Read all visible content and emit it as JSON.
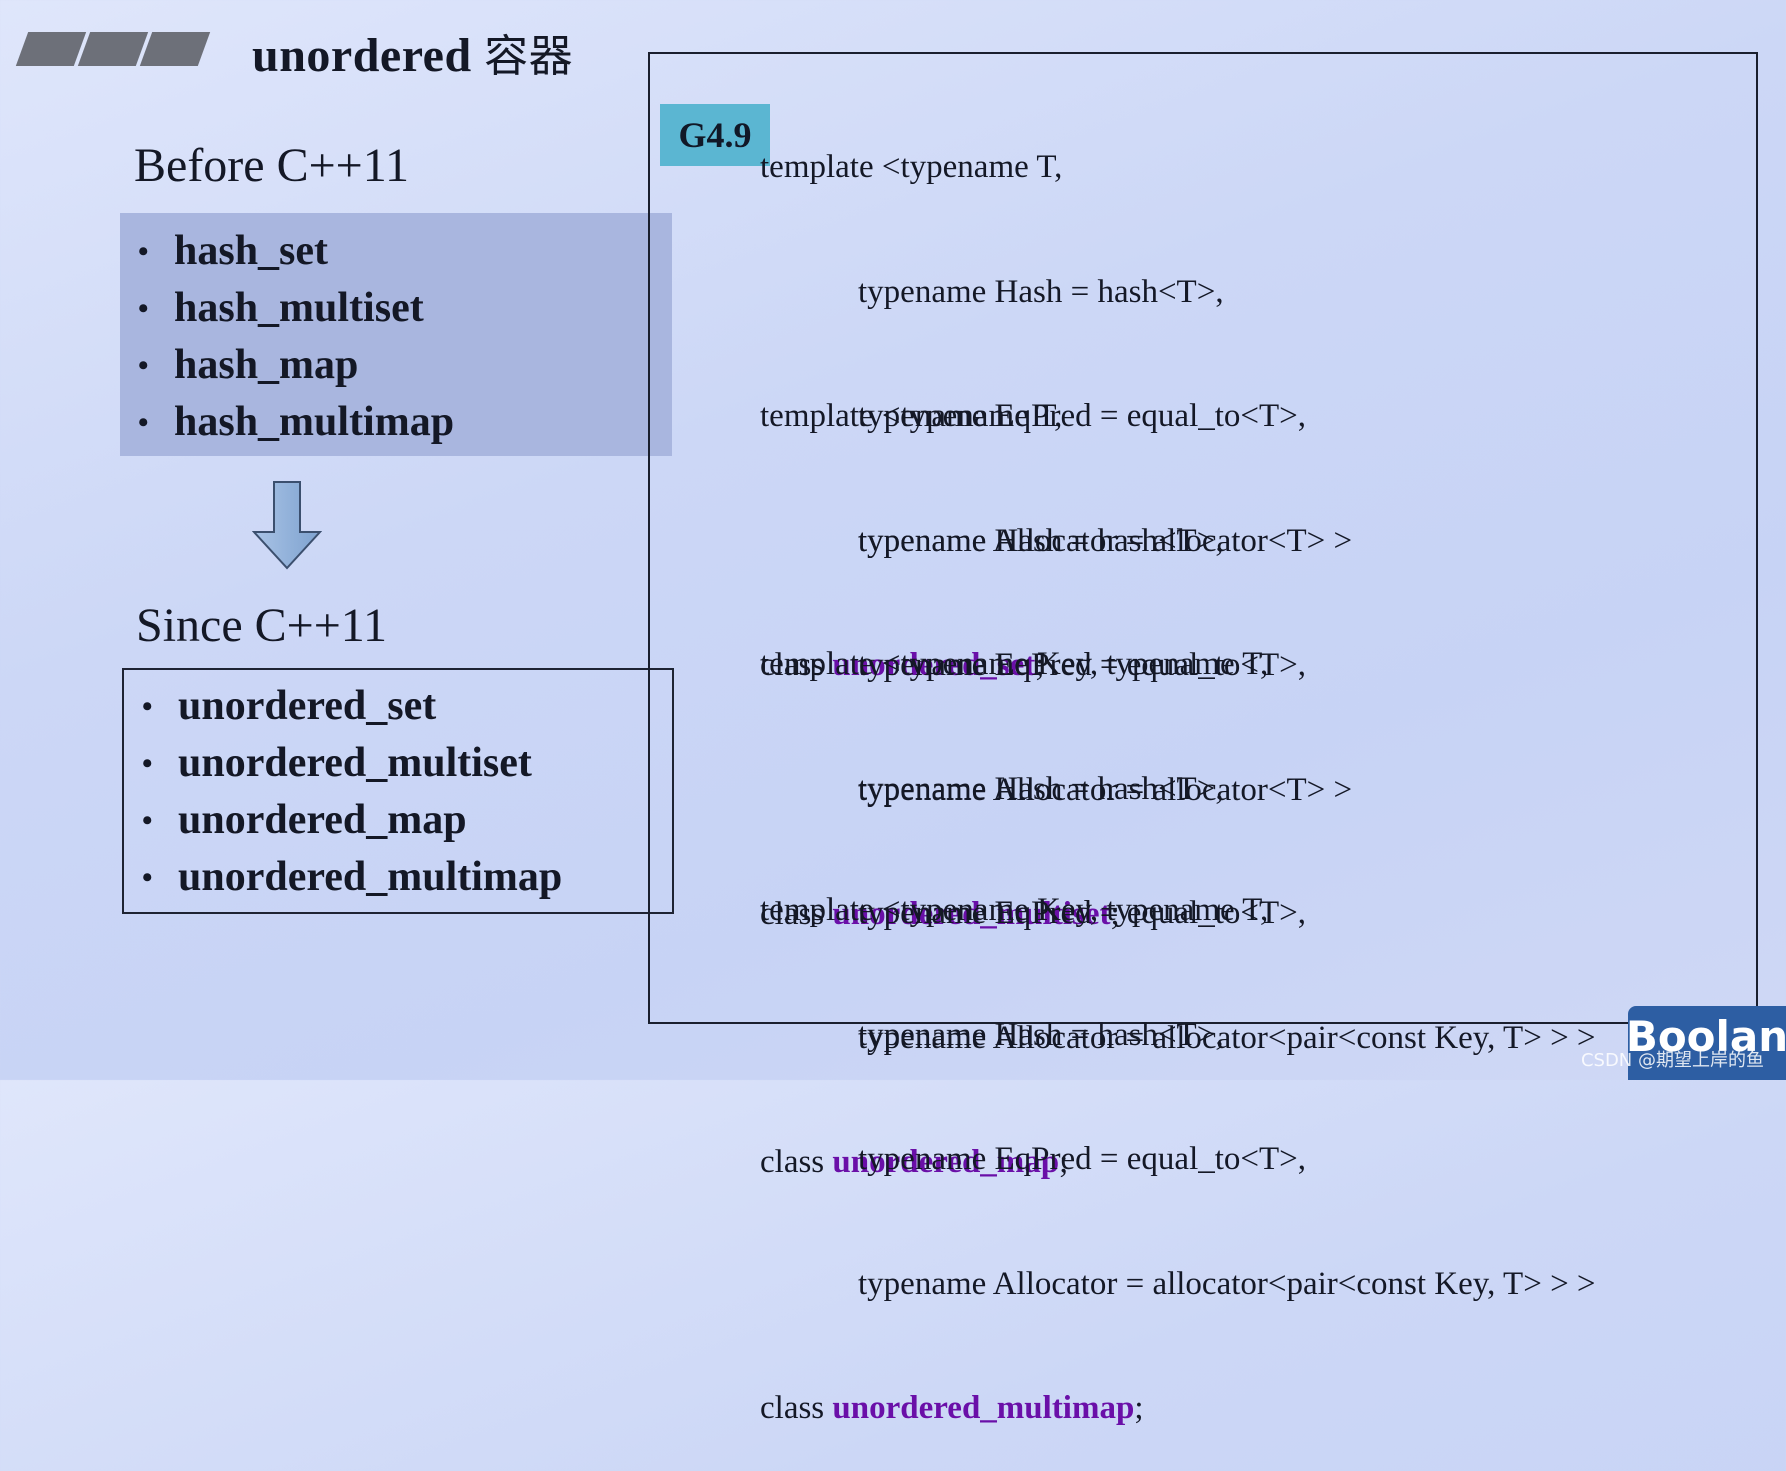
{
  "slide": {
    "title_latin": "unordered ",
    "title_cjk": "容器",
    "decor_icon": "slanted-bars-decoration"
  },
  "before": {
    "heading": "Before C++11",
    "items": [
      "hash_set",
      "hash_multiset",
      "hash_map",
      "hash_multimap"
    ],
    "box_color": "#a9b6df"
  },
  "arrow": {
    "icon": "down-arrow-icon",
    "color": "#8fb0d8"
  },
  "since": {
    "heading": "Since C++11",
    "items": [
      "unordered_set",
      "unordered_multiset",
      "unordered_map",
      "unordered_multimap"
    ]
  },
  "badge": {
    "label": "G4.9",
    "color": "#5bb6d2"
  },
  "code": {
    "highlight_color": "#6a0fa8",
    "blocks": [
      {
        "lines": [
          "template <typename T,",
          "typename Hash = hash<T>,",
          "typename EqPred = equal_to<T>,",
          "typename Allocator = allocator<T> >"
        ],
        "class_keyword": "class ",
        "class_name": "unordered_set",
        "terminator": ";"
      },
      {
        "lines": [
          "template <typename T,",
          "typename Hash = hash<T>,",
          "typename EqPred = equal_to<T>,",
          "typename Allocator = allocator<T> >"
        ],
        "class_keyword": "class ",
        "class_name": "unordered_multiset",
        "terminator": ";"
      },
      {
        "lines": [
          "template <typename Key, typename T,",
          "typename Hash = hash<T>,",
          "typename EqPred = equal_to<T>,",
          "typename Allocator = allocator<pair<const Key, T> > >"
        ],
        "class_keyword": "class ",
        "class_name": "unordered_map",
        "terminator": ";"
      },
      {
        "lines": [
          "template <typename Key, typename T,",
          "typename Hash = hash<T>,",
          "typename EqPred = equal_to<T>,",
          "typename Allocator = allocator<pair<const Key, T> > >"
        ],
        "class_keyword": "class ",
        "class_name": "unordered_multimap",
        "terminator": ";"
      }
    ]
  },
  "logo": {
    "text": "Boolan",
    "color": "#2d5ea3"
  },
  "watermark": {
    "text": "CSDN @期望上岸的鱼"
  }
}
